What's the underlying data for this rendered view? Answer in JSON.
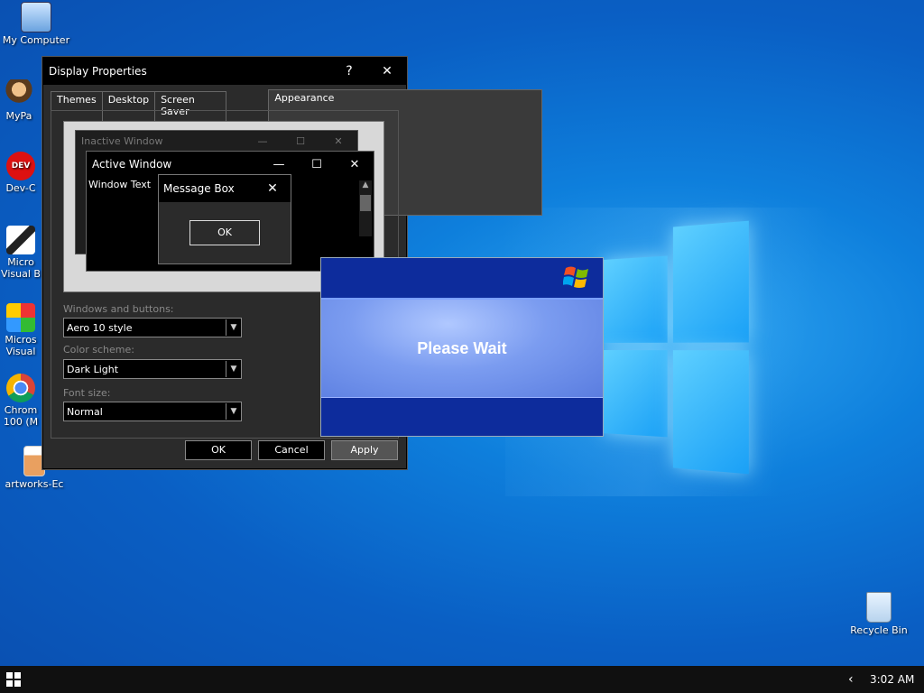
{
  "desktop": {
    "icons": [
      {
        "label": "My Computer",
        "icon": "computer-icon"
      },
      {
        "label": "MyPa",
        "icon": "person-icon"
      },
      {
        "label": "Dev-C",
        "icon": "devcpp-icon"
      },
      {
        "label": "Micro",
        "label2": "Visual B",
        "icon": "vb-icon"
      },
      {
        "label": "Micros",
        "label2": "Visual",
        "icon": "office-icon"
      },
      {
        "label": "Chrom",
        "label2": "100 (M",
        "icon": "chrome-icon"
      },
      {
        "label": "artworks-Ec",
        "icon": "image-file-icon"
      },
      {
        "label": "Recycle Bin",
        "icon": "recycle-bin-icon"
      }
    ]
  },
  "display_properties": {
    "title": "Display Properties",
    "help": "?",
    "close": "✕",
    "tabs": [
      "Themes",
      "Desktop",
      "Screen Saver",
      "Appearance"
    ],
    "active_tab": "Appearance",
    "preview": {
      "inactive_title": "Inactive Window",
      "active_title": "Active Window",
      "window_text": "Window Text",
      "message_box_title": "Message Box",
      "ok": "OK",
      "min": "—",
      "max": "☐",
      "close": "✕"
    },
    "windows_buttons_label": "Windows and buttons:",
    "windows_buttons_value": "Aero 10 style",
    "color_scheme_label": "Color scheme:",
    "color_scheme_value": "Dark Light",
    "font_size_label": "Font size:",
    "font_size_value": "Normal",
    "buttons": {
      "ok": "OK",
      "cancel": "Cancel",
      "apply": "Apply"
    }
  },
  "please_wait": {
    "text": "Please Wait"
  },
  "taskbar": {
    "time": "3:02 AM",
    "chevron": "‹"
  }
}
